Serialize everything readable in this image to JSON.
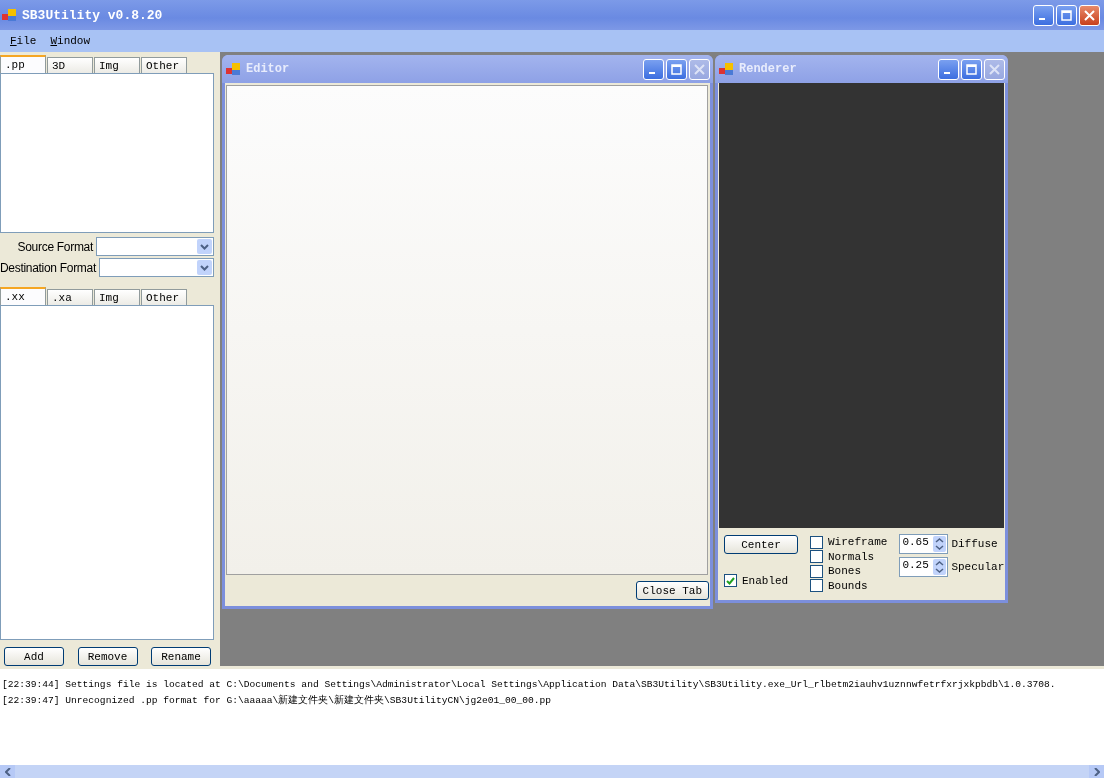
{
  "window": {
    "title": "SB3Utility v0.8.20"
  },
  "menu": [
    {
      "label": "File"
    },
    {
      "label": "Window"
    }
  ],
  "pp_tabs": [
    {
      "label": ".pp",
      "selected": true
    },
    {
      "label": "3D",
      "selected": false
    },
    {
      "label": "Img",
      "selected": false
    },
    {
      "label": "Other",
      "selected": false
    }
  ],
  "formats": [
    {
      "label": "Source Format"
    },
    {
      "label": "Destination Format"
    }
  ],
  "xx_tabs": [
    {
      "label": ".xx",
      "selected": true
    },
    {
      "label": ".xa",
      "selected": false
    },
    {
      "label": "Img",
      "selected": false
    },
    {
      "label": "Other",
      "selected": false
    }
  ],
  "buttons": [
    "Add",
    "Remove",
    "Rename"
  ],
  "editor": {
    "title": "Editor",
    "close_tab": "Close Tab"
  },
  "renderer": {
    "title": "Renderer",
    "center": "Center",
    "enabled": {
      "label": "Enabled",
      "checked": true
    },
    "options": [
      {
        "label": "Wireframe",
        "checked": false
      },
      {
        "label": "Normals",
        "checked": false
      },
      {
        "label": "Bones",
        "checked": false
      },
      {
        "label": "Bounds",
        "checked": false
      }
    ],
    "spinners": [
      {
        "value": "0.65",
        "label": "Diffuse"
      },
      {
        "value": "0.25",
        "label": "Specular"
      }
    ]
  },
  "log": [
    "[22:39:44] Settings file is located at C:\\Documents and Settings\\Administrator\\Local Settings\\Application Data\\SB3Utility\\SB3Utility.exe_Url_rlbetm2iauhv1uznnwfetrfxrjxkpbdb\\1.0.3708.",
    "[22:39:47] Unrecognized .pp format for G:\\aaaaa\\新建文件夹\\新建文件夹\\SB3UtilityCN\\jg2e01_00_00.pp"
  ]
}
